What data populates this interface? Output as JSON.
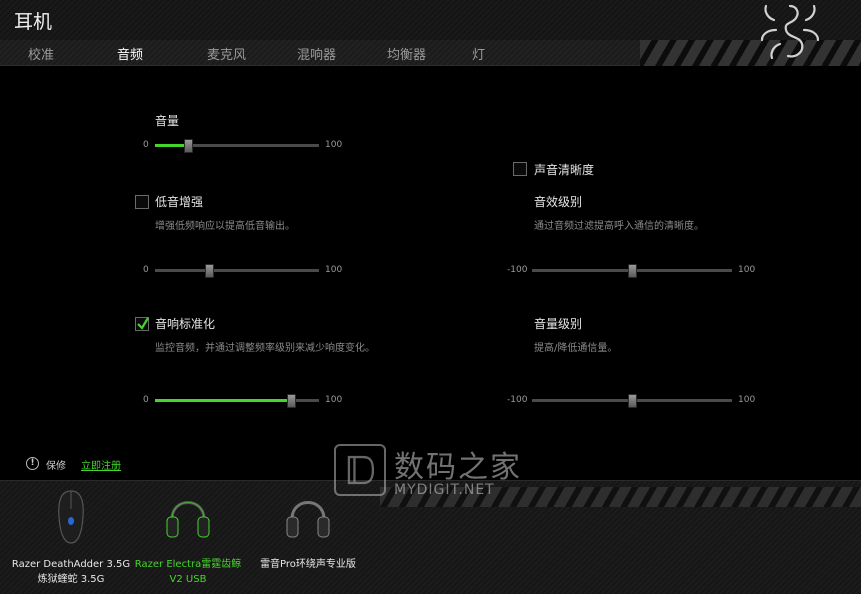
{
  "header": {
    "title": "耳机"
  },
  "tabs": [
    {
      "label": "校准"
    },
    {
      "label": "音频",
      "active": true
    },
    {
      "label": "麦克风"
    },
    {
      "label": "混响器"
    },
    {
      "label": "均衡器"
    },
    {
      "label": "灯"
    }
  ],
  "audio": {
    "volume": {
      "label": "音量",
      "min": "0",
      "max": "100",
      "value": 20
    },
    "bass_boost": {
      "label": "低音增强",
      "checked": false,
      "desc": "增强低频响应以提高低音输出。",
      "min": "0",
      "max": "100",
      "value": 33
    },
    "sound_normalization": {
      "label": "音响标准化",
      "checked": true,
      "desc": "监控音频，并通过调整频率级别来减少响度变化。",
      "min": "0",
      "max": "100",
      "value": 83
    },
    "voice_clarity": {
      "label": "声音清晰度",
      "checked": false
    },
    "effect_level": {
      "label": "音效级别",
      "desc": "通过音频过滤提高呼入通信的清晰度。",
      "min": "-100",
      "max": "100",
      "value": 0
    },
    "volume_level": {
      "label": "音量级别",
      "desc": "提高/降低通信量。",
      "min": "-100",
      "max": "100",
      "value": 0
    }
  },
  "footer": {
    "warranty_label": "保修",
    "register_link": "立即注册"
  },
  "devices": [
    {
      "name_line1": "Razer DeathAdder 3.5G",
      "name_line2": "炼狱蝰蛇 3.5G",
      "icon": "mouse-icon"
    },
    {
      "name_line1": "Razer Electra雷霆齿鲸",
      "name_line2": "V2 USB",
      "icon": "headset-icon",
      "active": true
    },
    {
      "name_line1": "雷音Pro环绕声专业版",
      "name_line2": "",
      "icon": "headset-icon"
    }
  ],
  "watermark": {
    "cn": "数码之家",
    "en": "MYDIGIT.NET"
  },
  "colors": {
    "accent": "#44d62c",
    "background": "#000000",
    "track": "#4a4a4a"
  }
}
